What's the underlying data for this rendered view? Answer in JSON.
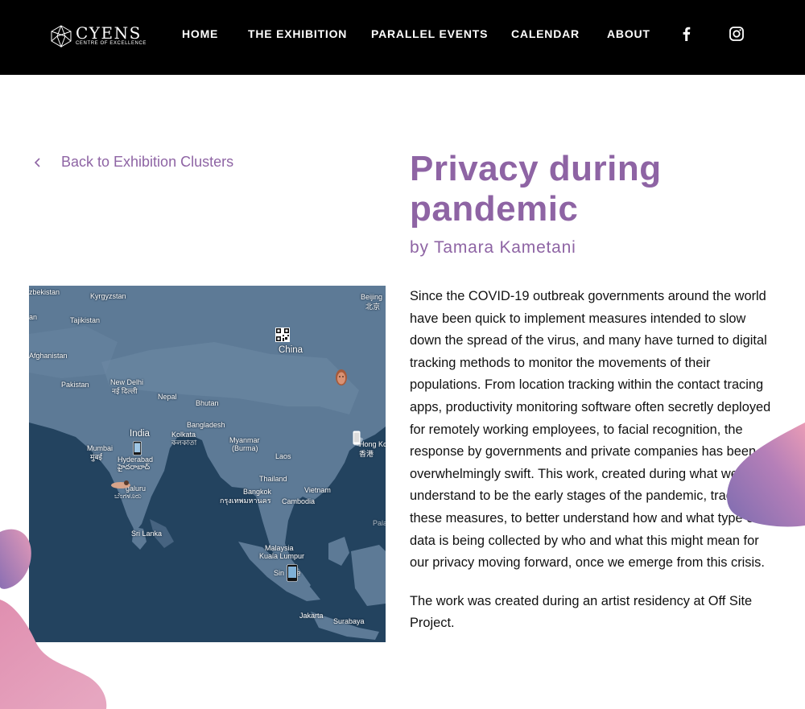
{
  "header": {
    "logo": {
      "name": "CYENS",
      "tagline": "CENTRE OF EXCELLENCE"
    },
    "nav": [
      {
        "id": "home",
        "label": "HOME"
      },
      {
        "id": "exhibition",
        "label": "THE EXHIBITION"
      },
      {
        "id": "parallel",
        "label": "PARALLEL EVENTS"
      },
      {
        "id": "calendar",
        "label": "CALENDAR"
      },
      {
        "id": "about",
        "label": "ABOUT"
      }
    ],
    "social": [
      "facebook-icon",
      "instagram-icon"
    ]
  },
  "back_link": {
    "label": "Back to Exhibition Clusters"
  },
  "artwork": {
    "title": "Privacy during pandemic",
    "byline": "by Tamara Kametani",
    "paragraphs": [
      "Since the COVID-19 outbreak governments around the world have been quick to implement measures intended to slow down the spread of the virus, and many have turned to digital tracking methods to monitor the movements of their populations. From location tracking within the contact tracing apps, productivity monitoring software often secretly deployed for remotely working employees, to facial recognition, the response by governments and private companies has been overwhelmingly swift. This work, created during what we now understand to be the early stages of the pandemic, tracks these measures, to better understand how and what type of data is being collected by who and what this might mean for our privacy moving forward, once we emerge from this crisis.",
      "The work was created during an artist residency at Off Site Project."
    ]
  },
  "map": {
    "labels": {
      "uzbekistan": "zbekistan",
      "kyrgyzstan": "Kyrgyzstan",
      "beijing_en": "Beijing",
      "beijing_local": "北京",
      "an": "an",
      "tajikistan": "Tajikistan",
      "china": "China",
      "afghanistan": "Afghanistan",
      "pakistan": "Pakistan",
      "new_delhi_en": "New Delhi",
      "new_delhi_local": "नई दिल्ली",
      "nepal": "Nepal",
      "bhutan": "Bhutan",
      "bangladesh": "Bangladesh",
      "india": "India",
      "kolkata_en": "Kolkata",
      "kolkata_local": "কলকাতা",
      "myanmar": "Myanmar",
      "burma": "(Burma)",
      "hong_kong": "Hong Ko",
      "hong_kong_local": "香港",
      "mumbai_en": "Mumbai",
      "mumbai_local": "मुंबई",
      "hyderabad_en": "Hyderabad",
      "hyderabad_local": "హైదరాబాద్",
      "laos": "Laos",
      "thailand": "Thailand",
      "bengaluru_en": "galuru",
      "bengaluru_local": "ಬೆಂಗಳೂರು",
      "bangkok_en": "Bangkok",
      "bangkok_local": "กรุงเทพมหานคร",
      "vietnam": "Vietnam",
      "cambodia": "Cambodia",
      "palau": "Palau",
      "sri_lanka": "Sri Lanka",
      "malaysia": "Malaysia",
      "kuala_lumpur": "Kuala Lumpur",
      "singapore": "Sin     re",
      "jakarta": "Jakarta",
      "surabaya": "Surabaya"
    },
    "markers": [
      "qr-code",
      "face",
      "phone",
      "person",
      "phone",
      "phone"
    ]
  },
  "colors": {
    "header_bg": "#000000",
    "accent_purple": "#8e64a4",
    "body_text": "#111111",
    "map_water": "#23435f",
    "map_land": "#5d7a96",
    "blob_pink": "#e39ab8",
    "blob_violet": "#7c6cb0"
  }
}
